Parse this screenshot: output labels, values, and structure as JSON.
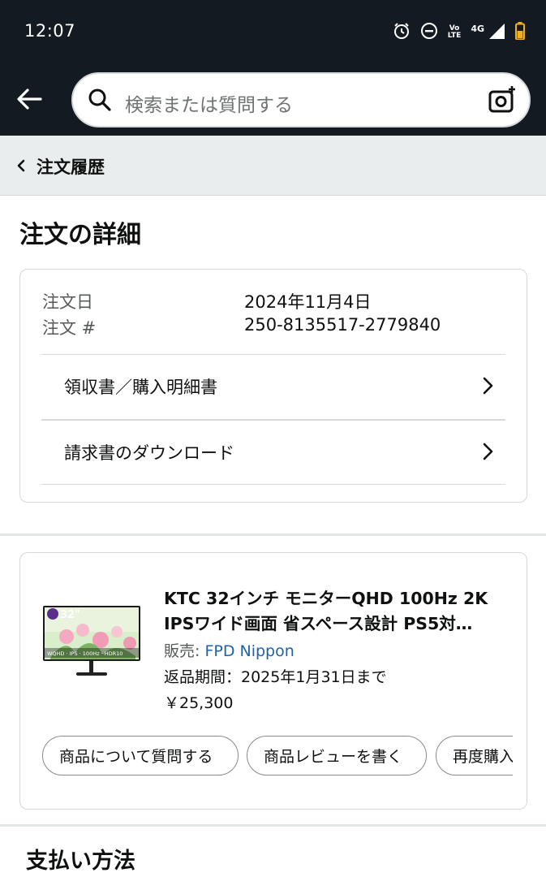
{
  "status_bar": {
    "time": "12:07",
    "network": "4G",
    "volte": "Vo LTE",
    "icons": [
      "alarm-icon",
      "dnd-icon",
      "volte-icon",
      "signal-icon",
      "battery-icon"
    ]
  },
  "search": {
    "placeholder": "検索または質問する"
  },
  "breadcrumb": {
    "label": "注文履歴"
  },
  "page": {
    "title": "注文の詳細"
  },
  "order": {
    "date_label": "注文日",
    "date_value": "2024年11月4日",
    "number_label": "注文 #",
    "number_value": "250-8135517-2779840",
    "links": [
      {
        "label": "領収書／購入明細書"
      },
      {
        "label": "請求書のダウンロード"
      }
    ]
  },
  "item": {
    "title": "KTC 32インチ モニターQHD 100Hz 2K IPSワイド画面 省スペース設計 PS5対…",
    "seller_prefix": "販売: ",
    "seller_name": "FPD Nippon",
    "return_period": "返品期間：2025年1月31日まで",
    "price": "￥25,300",
    "image_badge": "32\"",
    "image_badge_text": "WQHD · IPS · 100Hz · HDR10",
    "actions": [
      {
        "label": "商品について質問する"
      },
      {
        "label": "商品レビューを書く"
      },
      {
        "label": "再度購入"
      }
    ]
  },
  "payment": {
    "title": "支払い方法"
  },
  "colors": {
    "header_bg": "#131a22",
    "breadcrumb_bg": "#eaeded",
    "link": "#2162a1",
    "border": "#d5d9d9"
  }
}
